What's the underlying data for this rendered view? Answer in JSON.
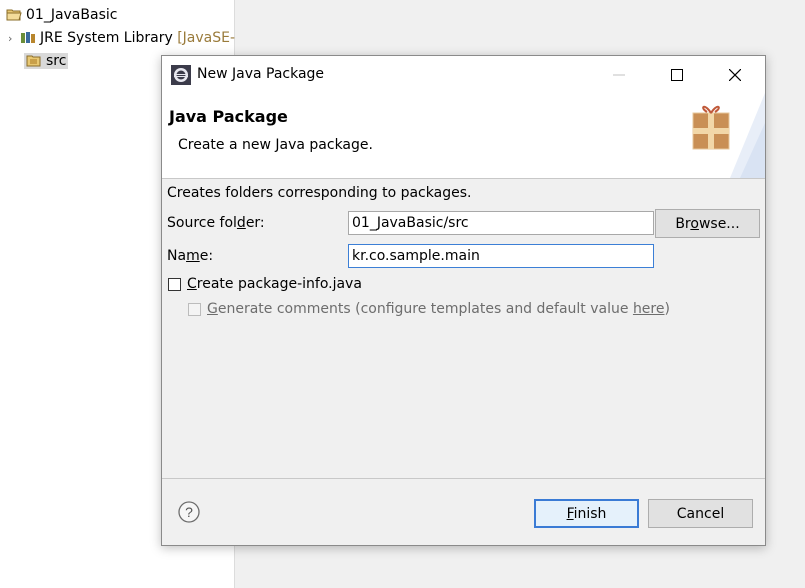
{
  "explorer": {
    "project": "01_JavaBasic",
    "jre_label": "JRE System Library",
    "jre_decoration": "[JavaSE-",
    "src_label": "src"
  },
  "dialog": {
    "title": "New Java Package",
    "banner_title": "Java Package",
    "banner_description": "Create a new Java package.",
    "intro": "Creates folders corresponding to packages.",
    "source_folder_label_pre": "Source fol",
    "source_folder_label_mn": "d",
    "source_folder_label_post": "er:",
    "source_folder_value": "01_JavaBasic/src",
    "browse_pre": "Br",
    "browse_mn": "o",
    "browse_post": "wse...",
    "name_label_pre": "Na",
    "name_label_mn": "m",
    "name_label_post": "e:",
    "name_value": "kr.co.sample.main",
    "create_info_mn": "C",
    "create_info_post": "reate package-info.java",
    "gen_comments_mn": "G",
    "gen_comments_mid": "enerate comments (configure templates and default value ",
    "gen_comments_link": "here",
    "gen_comments_end": ")",
    "finish_mn": "F",
    "finish_post": "inish",
    "cancel_label": "Cancel"
  },
  "colors": {
    "accent": "#3a7bd5",
    "field_border": "#a8a8a8",
    "decoration": "#9a7b3b"
  }
}
